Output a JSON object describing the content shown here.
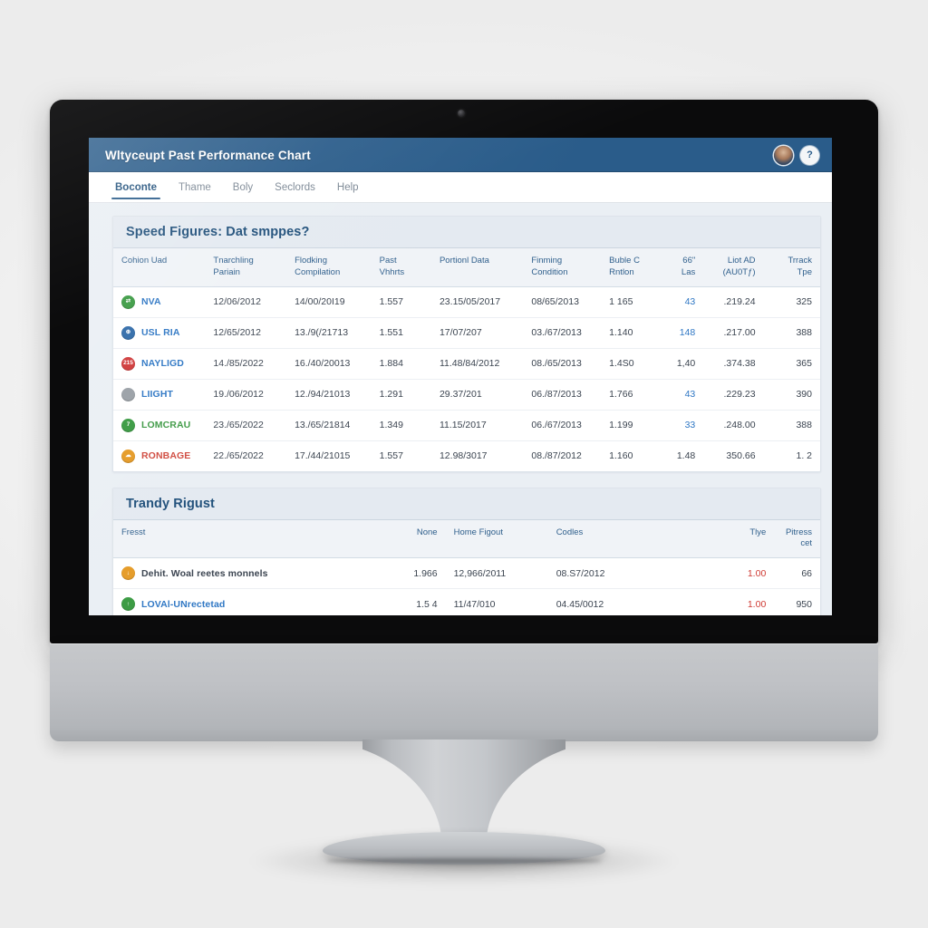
{
  "window": {
    "app_title": "Wltyceupt Past Performance Chart",
    "avatar_icon": "user-avatar-icon",
    "help_icon": "help-circle-icon",
    "help_label": "?"
  },
  "menubar": {
    "items": [
      {
        "label": "Boconte",
        "active": true
      },
      {
        "label": "Thame",
        "active": false
      },
      {
        "label": "Boly",
        "active": false
      },
      {
        "label": "Seclords",
        "active": false
      },
      {
        "label": "Help",
        "active": false
      }
    ]
  },
  "speed_card": {
    "title": "Speed Figures: Dat smppes?",
    "columns": [
      {
        "label": "Cohion Uad",
        "align": "left"
      },
      {
        "label": "Tnarchling Pariain",
        "align": "left"
      },
      {
        "label": "Flodking Compilation",
        "align": "left"
      },
      {
        "label": "Past Vhhrts",
        "align": "left"
      },
      {
        "label": "Portionl Data",
        "align": "left"
      },
      {
        "label": "Finming Condition",
        "align": "left"
      },
      {
        "label": "Buble C Rntlon",
        "align": "left"
      },
      {
        "label": "66\" Las",
        "align": "right"
      },
      {
        "label": "Liot AD (AU0Tƒ)",
        "align": "right"
      },
      {
        "label": "Trrack Tpe",
        "align": "right"
      }
    ],
    "rows": [
      {
        "badge": {
          "color": "#3a9a42",
          "glyph": "⇄",
          "name": "status-badge-green"
        },
        "name": "NVA",
        "name_color": "#2f77c4",
        "cells": [
          "12/06/2012",
          "14/00/20I19",
          "1.557",
          "23.15/05/2017",
          "08/65/2013",
          "1 165",
          "43",
          ".219.24",
          "325"
        ],
        "link_index": 6
      },
      {
        "badge": {
          "color": "#2f6aa8",
          "glyph": "⊕",
          "name": "status-badge-blue"
        },
        "name": "USL RIA",
        "name_color": "#2f77c4",
        "cells": [
          "12/65/2012",
          "13./9(/21713",
          "1.551",
          "17/07/207",
          "03./67/2013",
          "1.140",
          "148",
          ".217.00",
          "388"
        ],
        "link_index": 6
      },
      {
        "badge": {
          "color": "#d03a3a",
          "glyph": "215",
          "name": "status-badge-red"
        },
        "name": "NAYLIGD",
        "name_color": "#2f77c4",
        "cells": [
          "14./85/2022",
          "16./40/20013",
          "1.884",
          "11.48/84/2012",
          "08./65/2013",
          "1.4S0",
          "1,40",
          ".374.38",
          "365"
        ],
        "link_index": -1
      },
      {
        "badge": {
          "color": "#9aa0a6",
          "glyph": "",
          "name": "status-badge-photo"
        },
        "name": "LIIGHT",
        "name_color": "#2f77c4",
        "cells": [
          "19./06/2012",
          "12./94/21013",
          "1.291",
          "29.37/201",
          "06./87/2013",
          "1.766",
          "43",
          ".229.23",
          "390"
        ],
        "link_index": 6
      },
      {
        "badge": {
          "color": "#3a9a42",
          "glyph": "7",
          "name": "status-badge-green"
        },
        "name": "LOMCRAU",
        "name_color": "#3f9a46",
        "cells": [
          "23./65/2022",
          "13./65/21814",
          "1.349",
          "11.15/2017",
          "06./67/2013",
          "1.199",
          "33",
          ".248.00",
          "388"
        ],
        "link_index": 6
      },
      {
        "badge": {
          "color": "#e59b27",
          "glyph": "☁",
          "name": "status-badge-orange"
        },
        "name": "RONBAGE",
        "name_color": "#d04b40",
        "cells": [
          "22./65/2022",
          "17./44/21015",
          "1.557",
          "12.98/3017",
          "08./87/2012",
          "1.160",
          "1.48",
          "350.66",
          "1. 2"
        ],
        "link_index": -1
      }
    ]
  },
  "trandy_card": {
    "title": "Trandy Rigust",
    "columns": [
      {
        "label": "Fresst",
        "align": "left"
      },
      {
        "label": "None",
        "align": "right"
      },
      {
        "label": "Home Figout",
        "align": "left"
      },
      {
        "label": "Codles",
        "align": "left"
      },
      {
        "label": "",
        "align": "left"
      },
      {
        "label": "Tlye",
        "align": "right"
      },
      {
        "label": "Pitress cet",
        "align": "right"
      }
    ],
    "rows": [
      {
        "badge": {
          "color": "#e59b27",
          "glyph": "↓",
          "name": "status-badge-orange"
        },
        "name": "Dehit. Woal reetes monnels",
        "name_color": "#3b4450",
        "cells": [
          "1.966",
          "12,966/2011",
          "08.S7/2012",
          "",
          "1.00",
          "66"
        ],
        "red_index": 4
      },
      {
        "badge": {
          "color": "#3a9a42",
          "glyph": "↑",
          "name": "status-badge-green"
        },
        "name": "LOVAl-UNrectetad",
        "name_color": "#2f77c4",
        "cells": [
          "1.5 4",
          "11/47/010",
          "04.45/0012",
          "",
          "1.00",
          "950"
        ],
        "red_index": 4
      }
    ]
  }
}
